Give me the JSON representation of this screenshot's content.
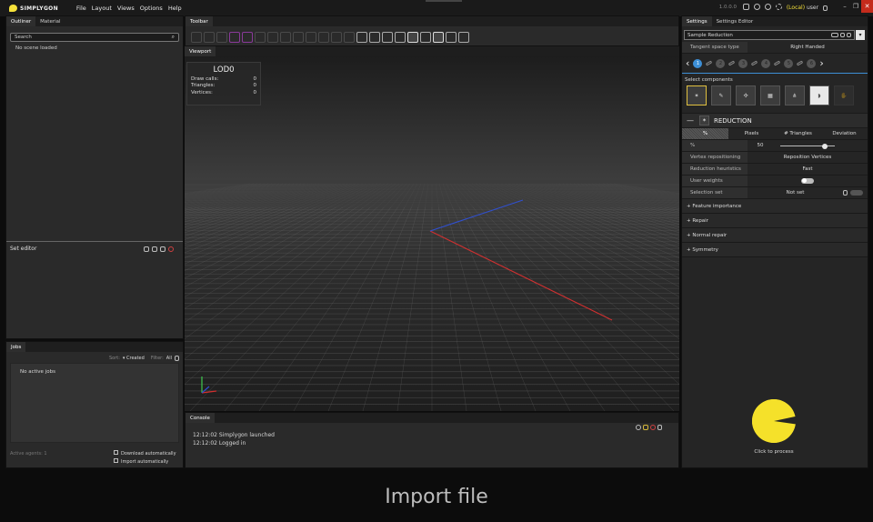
{
  "app": {
    "name": "SIMPLYGON",
    "version": "1.0.0.0",
    "user_prefix": "(Local)",
    "user": "user"
  },
  "menu": [
    "File",
    "Layout",
    "Views",
    "Options",
    "Help"
  ],
  "left_panel": {
    "tabs": [
      "Outliner",
      "Material"
    ],
    "search_placeholder": "Search",
    "empty_text": "No scene loaded",
    "set_editor_title": "Set editor"
  },
  "jobs": {
    "tab": "Jobs",
    "sort_label": "Sort:",
    "sort_value": "Created",
    "filter_label": "Filter:",
    "filter_value": "All",
    "empty_text": "No active jobs",
    "agents_label": "Active agents: 1",
    "download_label": "Download automatically",
    "import_label": "Import automatically"
  },
  "toolbar": {
    "tab": "Toolbar"
  },
  "viewport": {
    "tab": "Viewport",
    "lod_title": "LOD0",
    "stats": [
      {
        "label": "Draw calls:",
        "value": "0"
      },
      {
        "label": "Triangles:",
        "value": "0"
      },
      {
        "label": "Vertices:",
        "value": "0"
      }
    ]
  },
  "console": {
    "tab": "Console",
    "lines": [
      "12:12:02 Simplygon launched",
      "12:12:02 Logged in"
    ]
  },
  "settings": {
    "tabs": [
      "Settings",
      "Settings Editor"
    ],
    "preset": "Sample Reduction",
    "tangent_label": "Tangent space type",
    "tangent_value": "Right Handed",
    "steps": [
      "1",
      "2",
      "3",
      "4",
      "5",
      "6"
    ],
    "select_components": "Select components",
    "reduction_title": "REDUCTION",
    "mode_tabs": [
      "%",
      "Pixels",
      "# Triangles",
      "Deviation"
    ],
    "percent_label": "%",
    "percent_value": "50",
    "slider_fraction": 0.5,
    "vertex_label": "Vertex repositioning",
    "vertex_value": "Reposition Vertices",
    "heuristics_label": "Reduction heuristics",
    "heuristics_value": "Fast",
    "weights_label": "User weights",
    "selection_label": "Selection set",
    "selection_value": "Not set",
    "sections": [
      "Feature importance",
      "Repair",
      "Normal repair",
      "Symmetry"
    ],
    "process_label": "Click to process"
  },
  "caption": "Import file",
  "colors": {
    "accent": "#3d8fd6",
    "brand": "#f5e13a",
    "close": "#c42b1c",
    "axis_x": "#d03030",
    "axis_z": "#3050d0"
  }
}
